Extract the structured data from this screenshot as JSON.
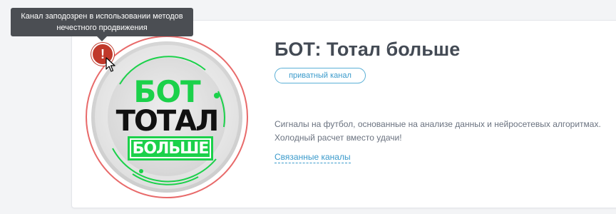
{
  "tooltip": {
    "line1": "Канал заподозрен в использовании методов",
    "line2": "нечестного продвижения"
  },
  "channel": {
    "title": "БОТ: Тотал больше",
    "badge": "приватный канал",
    "description_line1": "Сигналы на футбол, основанные на анализе данных и нейросетевых алгоритмах.",
    "description_line2": "Холодный расчет вместо удачи!",
    "related_link": "Связанные каналы"
  },
  "logo": {
    "line1": "БОТ",
    "line2": "ТОТАЛ",
    "line3": "БОЛЬШЕ",
    "accent_color": "#1bd14a"
  },
  "warning": {
    "icon": "exclamation-icon",
    "symbol": "!",
    "color": "#c0392b"
  },
  "colors": {
    "avatar_ring": "#e86a6a",
    "link": "#3a9acb",
    "title": "#434a54"
  }
}
